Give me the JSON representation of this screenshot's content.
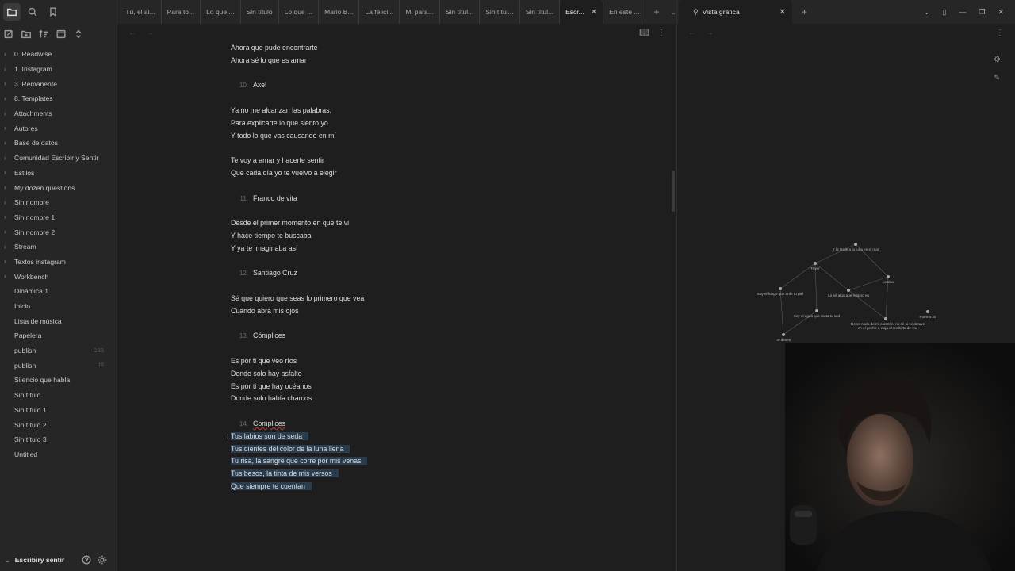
{
  "sidebar": {
    "items": [
      {
        "label": "0. Readwise",
        "folder": true
      },
      {
        "label": "1. Instagram",
        "folder": true
      },
      {
        "label": "3. Remanente",
        "folder": true
      },
      {
        "label": "8. Templates",
        "folder": true
      },
      {
        "label": "Attachments",
        "folder": true
      },
      {
        "label": "Autores",
        "folder": true
      },
      {
        "label": "Base de datos",
        "folder": true
      },
      {
        "label": "Comunidad Escribir y Sentir",
        "folder": true
      },
      {
        "label": "Estilos",
        "folder": true
      },
      {
        "label": "My dozen questions",
        "folder": true
      },
      {
        "label": "Sin nombre",
        "folder": true
      },
      {
        "label": "Sin nombre 1",
        "folder": true
      },
      {
        "label": "Sin nombre 2",
        "folder": true
      },
      {
        "label": "Stream",
        "folder": true
      },
      {
        "label": "Textos instagram",
        "folder": true
      },
      {
        "label": "Workbench",
        "folder": true
      },
      {
        "label": "Dinámica 1",
        "folder": false,
        "ext": ""
      },
      {
        "label": "Inicio",
        "folder": false,
        "ext": ""
      },
      {
        "label": "Lista de música",
        "folder": false,
        "ext": ""
      },
      {
        "label": "Papelera",
        "folder": false,
        "ext": ""
      },
      {
        "label": "publish",
        "folder": false,
        "ext": "CSS"
      },
      {
        "label": "publish",
        "folder": false,
        "ext": "JS"
      },
      {
        "label": "Silencio que habla",
        "folder": false,
        "ext": ""
      },
      {
        "label": "Sin título",
        "folder": false,
        "ext": ""
      },
      {
        "label": "Sin título 1",
        "folder": false,
        "ext": ""
      },
      {
        "label": "Sin título 2",
        "folder": false,
        "ext": ""
      },
      {
        "label": "Sin título 3",
        "folder": false,
        "ext": ""
      },
      {
        "label": "Untitled",
        "folder": false,
        "ext": ""
      }
    ],
    "vault_name": "Escribiry sentir"
  },
  "tabs": [
    {
      "label": "Tú, el ai...",
      "active": false
    },
    {
      "label": "Para to...",
      "active": false
    },
    {
      "label": "Lo que ...",
      "active": false
    },
    {
      "label": "Sin título",
      "active": false
    },
    {
      "label": "Lo que ...",
      "active": false
    },
    {
      "label": "Mario B...",
      "active": false
    },
    {
      "label": "La felici...",
      "active": false
    },
    {
      "label": "Mi para...",
      "active": false
    },
    {
      "label": "Sin títul...",
      "active": false
    },
    {
      "label": "Sin títul...",
      "active": false
    },
    {
      "label": "Sin títul...",
      "active": false
    },
    {
      "label": "Escr...",
      "active": true
    },
    {
      "label": "En este ...",
      "active": false
    }
  ],
  "document": {
    "lines": [
      {
        "text": "Ahora que pude encontrarte"
      },
      {
        "text": "Ahora sé lo que es amar"
      },
      {
        "text": ""
      },
      {
        "num": "10.",
        "text": "Axel",
        "heading": true
      },
      {
        "text": ""
      },
      {
        "text": "Ya no me alcanzan las palabras,"
      },
      {
        "text": "Para explicarte lo que siento yo"
      },
      {
        "text": "Y todo lo que vas causando en mí"
      },
      {
        "text": ""
      },
      {
        "text": "Te voy a amar y hacerte sentir"
      },
      {
        "text": "Que cada día yo te vuelvo a elegir"
      },
      {
        "text": ""
      },
      {
        "num": "11.",
        "text": "Franco de vita",
        "heading": true
      },
      {
        "text": ""
      },
      {
        "text": "Desde el primer momento en que te vi"
      },
      {
        "text": "Y hace tiempo te buscaba"
      },
      {
        "text": "Y ya te imaginaba así"
      },
      {
        "text": ""
      },
      {
        "num": "12.",
        "text": "Santiago Cruz",
        "heading": true
      },
      {
        "text": ""
      },
      {
        "text": "Sé que quiero que seas lo primero que vea"
      },
      {
        "text": "Cuando abra mis ojos"
      },
      {
        "text": ""
      },
      {
        "num": "13.",
        "text": "Cómplices",
        "heading": true
      },
      {
        "text": ""
      },
      {
        "text": "Es por ti que veo ríos"
      },
      {
        "text": "Donde solo hay asfalto"
      },
      {
        "text": "Es por ti que hay océanos"
      },
      {
        "text": "Donde solo había charcos"
      },
      {
        "text": ""
      },
      {
        "num": "14.",
        "text": "Complices",
        "heading": true,
        "spell": true
      },
      {
        "text": "Tus labios son de seda",
        "selected": true
      },
      {
        "text": "Tus dientes del color de la luna llena",
        "selected": true
      },
      {
        "text": "Tu risa, la sangre que corre por mis venas",
        "selected": true
      },
      {
        "text": "Tus besos, la tinta de mis versos",
        "selected": true
      },
      {
        "text": "Que siempre te cuentan",
        "selected": true
      }
    ]
  },
  "graph_pane": {
    "tab_label": "Vista gráfica",
    "nodes": [
      {
        "label": "Y la tarde a la luna en el mar"
      },
      {
        "label": "Tayer"
      },
      {
        "label": "Lo sino"
      },
      {
        "label": "Soy el fuego que arde tu piel"
      },
      {
        "label": "Lo sé algo que respiro yo"
      },
      {
        "label": "Soy el agua que mata tu sed"
      },
      {
        "label": "Poema 20"
      },
      {
        "label": "No se nada de mi corazón, no sé si se detuvo en el pecho o viaja al recibirte de voz"
      },
      {
        "label": "Te deseo"
      }
    ]
  }
}
